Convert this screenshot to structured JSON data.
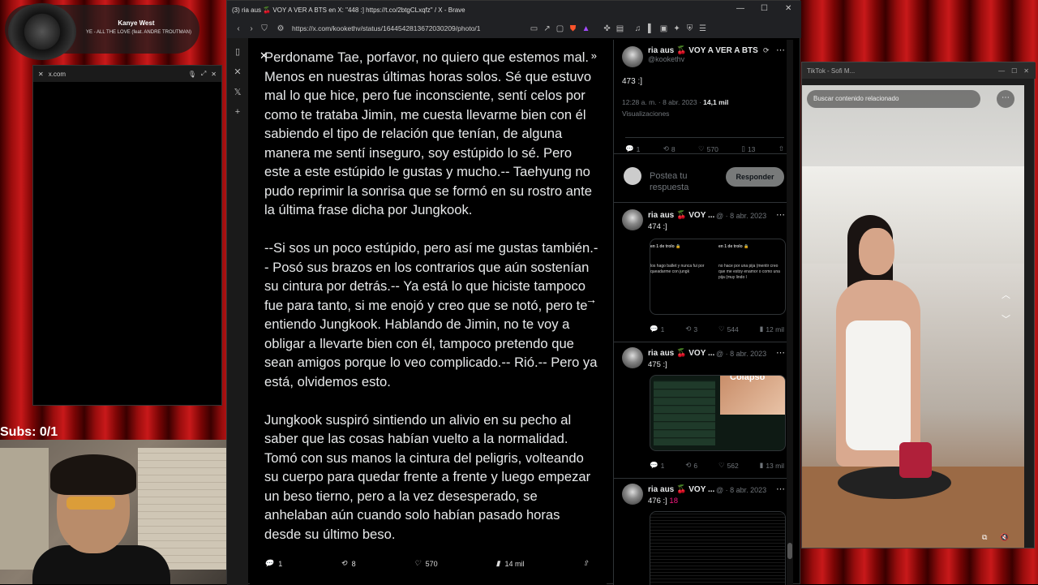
{
  "music": {
    "artist": "Kanye West",
    "song": "YE - ALL THE LOVE (feat. ANDRE TROUTMAN)"
  },
  "mini_window": {
    "domain": "x.com"
  },
  "overlay": {
    "subs": "Subs: 0/1"
  },
  "browser": {
    "title": "(3) ria aus 🍒 VOY A VER A BTS en X: \"448 :] https://t.co/2btgCLxqfz\" / X - Brave",
    "url": "https://x.com/kookethv/status/1644542813672030209/photo/1"
  },
  "story": {
    "paragraphs": [
      "Perdoname Tae, porfavor, no quiero que estemos mal. Menos en nuestras últimas horas solos. Sé que estuvo mal lo que hice, pero fue inconsciente, sentí celos por como te trataba Jimin, me cuesta llevarme bien con él sabiendo el tipo de relación que tenían, de alguna manera me sentí inseguro, soy estúpido lo sé. Pero este a este estúpido le gustas y mucho.-- Taehyung no pudo reprimir la sonrisa que se formó en su rostro ante la última frase dicha por Jungkook.",
      "--Si sos un poco estúpido, pero así me gustas también.-- Posó sus brazos en los contrarios que aún sostenían su cintura por detrás.-- Ya está lo que hiciste tampoco fue para tanto, si me enojó y creo que se notó, pero te entiendo Jungkook. Hablando de Jimin, no te voy a obligar a llevarte bien con él, tampoco pretendo que sean amigos porque lo veo complicado.-- Rió.-- Pero ya está, olvidemos esto.",
      "Jungkook suspiró sintiendo un alivio en su pecho al saber que las cosas habían vuelto a la normalidad. Tomó con sus manos la cintura del peligris, volteando su cuerpo para quedar frente a frente y luego empezar un beso tierno, pero a la vez desesperado, se anhelaban aún cuando solo habían pasado horas desde su último beso."
    ]
  },
  "photo_stats": {
    "replies": "1",
    "reposts": "8",
    "likes": "570",
    "views": "14 mil"
  },
  "main_tweet": {
    "name": "ria aus 🍒 VOY A VER A BTS",
    "handle": "@kookethv",
    "text": "473 :]",
    "time": "12:28 a. m. · 8 abr. 2023 · ",
    "views_count": "14,1 mil",
    "views_label": "Visualizaciones",
    "replies": "1",
    "reposts": "8",
    "likes": "570",
    "bookmarks": "13"
  },
  "composer": {
    "placeholder": "Postea tu respuesta",
    "button": "Responder"
  },
  "replies": [
    {
      "name": "ria aus 🍒 VOY ...",
      "meta": "@ · 8 abr. 2023",
      "text": "474 :]",
      "replies": "1",
      "reposts": "3",
      "likes": "544",
      "views": "12 mil",
      "thumb_left": {
        "handle": "en 1 de trolo 🔒",
        "text": "los hago ballet y nunca fui por queadarme con jungk"
      },
      "thumb_right": {
        "handle": "en 1 de trolo 🔒",
        "text": "no hace por una pija (mentir creo que me estoy enamor o como una pija (muy lindo l"
      }
    },
    {
      "name": "ria aus 🍒 VOY ...",
      "meta": "@ · 8 abr. 2023",
      "text": "475 :]",
      "replies": "1",
      "reposts": "6",
      "likes": "562",
      "views": "13 mil",
      "thumb_label": "Colapso"
    },
    {
      "name": "ria aus 🍒 VOY ...",
      "meta": "@ · 8 abr. 2023",
      "text": "476 :]",
      "badge": "18"
    }
  ],
  "tiktok": {
    "title": "TikTok - Sofi M...",
    "search_placeholder": "Buscar contenido relacionado"
  }
}
